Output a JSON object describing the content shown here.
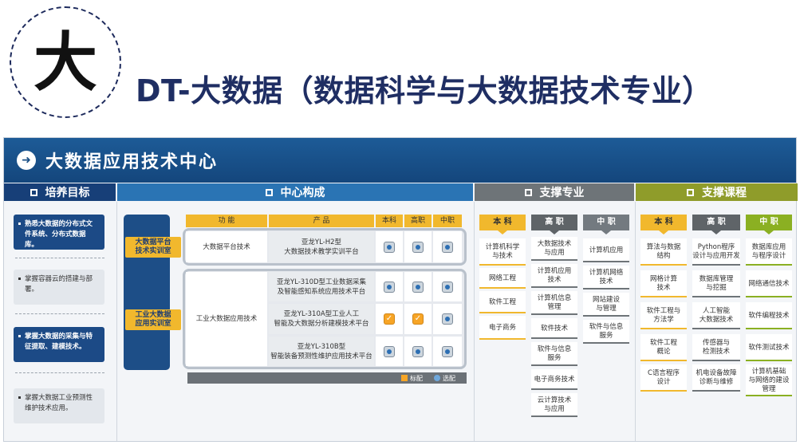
{
  "logo": {
    "char": "大"
  },
  "title": "DT-大数据（数据科学与大数据技术专业）",
  "banner": {
    "arrow": "➜",
    "title": "大数据应用技术中心"
  },
  "sections": {
    "goals": "培养目标",
    "center": "中心构成",
    "majors": "支撑专业",
    "courses": "支撑课程"
  },
  "goals": [
    {
      "text": "熟悉大数据的分布式文件系统、分布式数据库。",
      "active": true
    },
    {
      "text": "掌握容器云的搭建与部署。",
      "active": false
    },
    {
      "text": "掌握大数据的采集与特征提取、建模技术。",
      "active": true
    },
    {
      "text": "掌握大数据工业预测性维护技术应用。",
      "active": false
    }
  ],
  "center": {
    "columns": [
      "功 能",
      "产 品",
      "本科",
      "高职",
      "中职"
    ],
    "labs": [
      {
        "name": "大数据平台\n技术实训室",
        "function": "大数据平台技术"
      },
      {
        "name": "工业大数据\n应用实训室",
        "function": "工业大数据应用技术"
      }
    ],
    "products": [
      {
        "name": "亚龙YL-H2型\n大数据技术教学实训平台",
        "marks": [
          "optional",
          "optional",
          "optional"
        ]
      },
      {
        "name": "亚龙YL-310D型工业数据采集\n及智能感知系统应用技术平台",
        "marks": [
          "optional",
          "optional",
          "optional"
        ]
      },
      {
        "name": "亚龙YL-310A型工业人工\n智能及大数据分析建模技术平台",
        "marks": [
          "standard",
          "standard",
          "optional"
        ]
      },
      {
        "name": "亚龙YL-310B型\n智能装备预测性维护应用技术平台",
        "marks": [
          "optional",
          "optional",
          "optional"
        ]
      }
    ],
    "legend": {
      "standard": "标配",
      "optional": "选配"
    }
  },
  "majors": {
    "benke": {
      "label": "本 科",
      "items": [
        "计算机科学\n与技术",
        "网络工程",
        "软件工程",
        "电子商务"
      ]
    },
    "gaozhi": {
      "label": "高 职",
      "items": [
        "大数据技术\n与应用",
        "计算机应用\n技术",
        "计算机信息\n管理",
        "软件技术",
        "软件与信息\n服务",
        "电子商务技术",
        "云计算技术\n与应用"
      ]
    },
    "zhongzhi": {
      "label": "中 职",
      "items": [
        "计算机应用",
        "计算机网络\n技术",
        "网站建设\n与管理",
        "软件与信息\n服务"
      ]
    }
  },
  "courses": {
    "benke": {
      "label": "本 科",
      "items": [
        "算法与数据\n结构",
        "网格计算\n技术",
        "软件工程与\n方法学",
        "软件工程\n概论",
        "C语言程序\n设计"
      ]
    },
    "gaozhi": {
      "label": "高 职",
      "items": [
        "Python程序\n设计与应用开发",
        "数据库管理\n与挖掘",
        "人工智能\n大数据技术",
        "传感器与\n检测技术",
        "机电设备故障\n诊断与维修"
      ]
    },
    "zhongzhi": {
      "label": "中 职",
      "items": [
        "数据库应用\n与程序设计",
        "网络通信技术",
        "软件编程技术",
        "软件测试技术",
        "计算机基础\n与网络的建设\n管理"
      ]
    }
  },
  "colors": {
    "title": "#1f2e63",
    "banner": "#1a5590",
    "yellow": "#f1b82d",
    "green": "#8bb022",
    "gray": "#6e7478"
  }
}
